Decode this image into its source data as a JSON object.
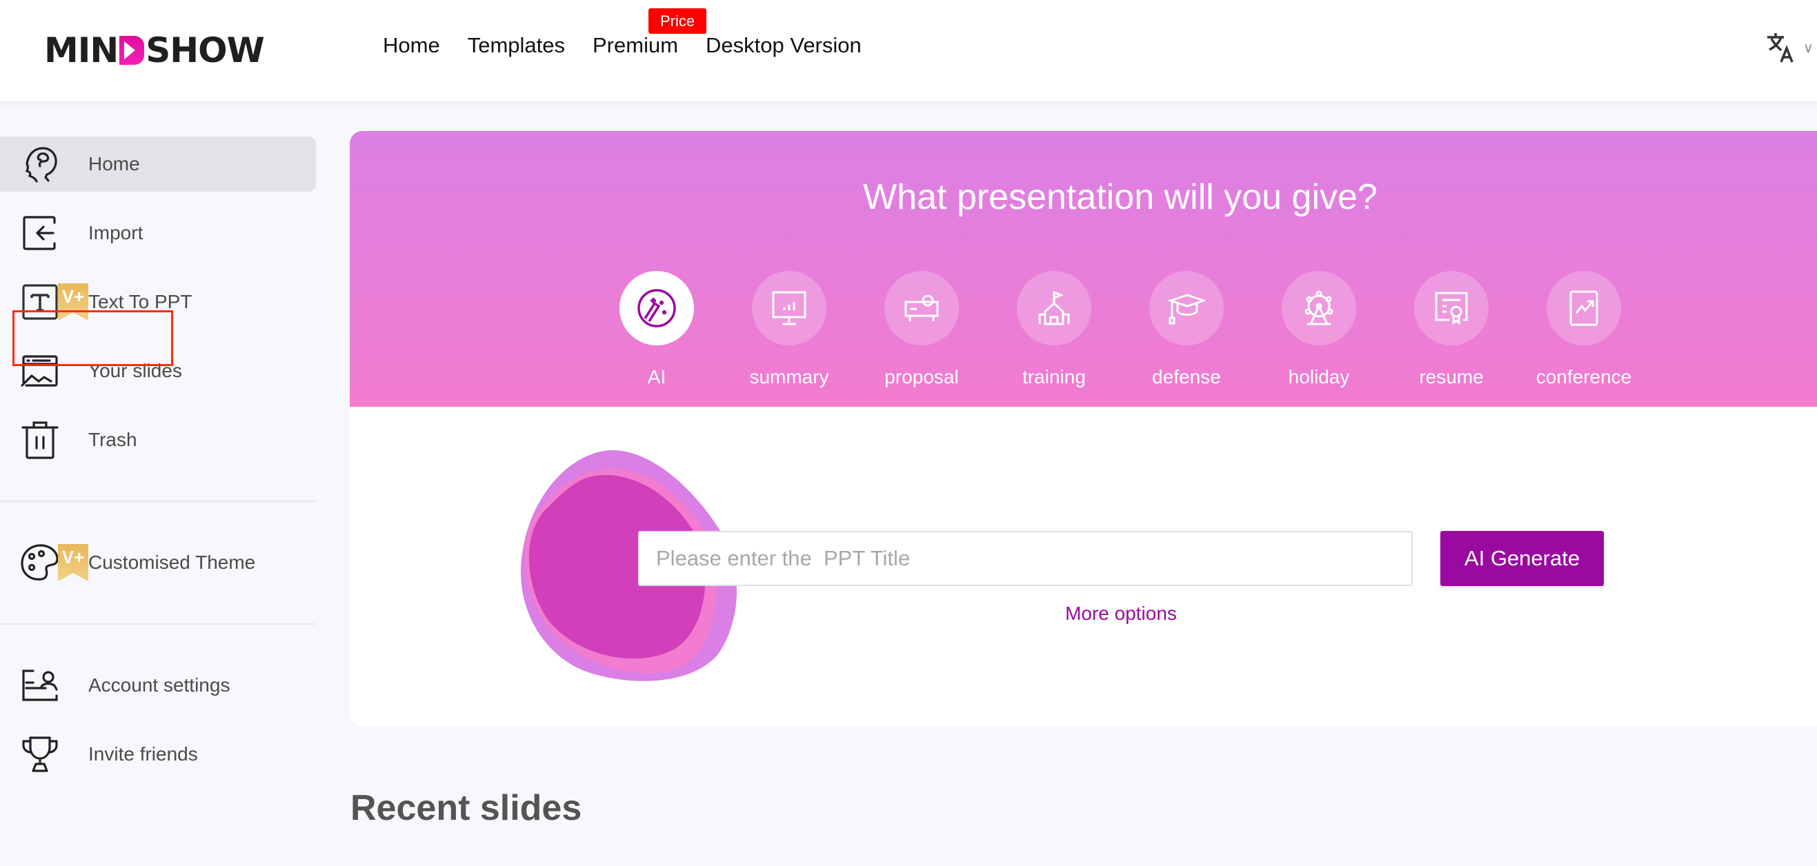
{
  "header": {
    "logo": {
      "part1": "MIN",
      "part2": "SHOW"
    },
    "nav": [
      {
        "label": "Home"
      },
      {
        "label": "Templates"
      },
      {
        "label": "Premium"
      },
      {
        "label": "Desktop Version"
      }
    ],
    "price_badge": "Price",
    "language_icon": "translate-icon"
  },
  "sidebar": {
    "items": [
      {
        "label": "Home",
        "icon": "brain-head-icon",
        "active": true
      },
      {
        "label": "Import",
        "icon": "import-icon",
        "highlighted": true
      },
      {
        "label": "Text To PPT",
        "icon": "text-icon",
        "badge": "V+"
      },
      {
        "label": "Your slides",
        "icon": "slides-icon"
      },
      {
        "label": "Trash",
        "icon": "trash-icon"
      },
      {
        "label": "Customised Theme",
        "icon": "palette-icon",
        "badge": "V+"
      },
      {
        "label": "Account settings",
        "icon": "account-icon"
      },
      {
        "label": "Invite friends",
        "icon": "trophy-icon"
      }
    ]
  },
  "banner": {
    "title": "What presentation will you give?",
    "categories": [
      {
        "label": "AI",
        "icon": "ai-magic-icon",
        "active": true
      },
      {
        "label": "summary",
        "icon": "chart-board-icon"
      },
      {
        "label": "proposal",
        "icon": "projector-icon"
      },
      {
        "label": "training",
        "icon": "school-flag-icon"
      },
      {
        "label": "defense",
        "icon": "graduation-cap-icon"
      },
      {
        "label": "holiday",
        "icon": "ferris-wheel-icon"
      },
      {
        "label": "resume",
        "icon": "certificate-icon"
      },
      {
        "label": "conference",
        "icon": "trend-chart-icon"
      }
    ]
  },
  "generator": {
    "input_value": "",
    "input_placeholder": "Please enter the  PPT Title",
    "generate_label": "AI Generate",
    "more_options_label": "More options"
  },
  "recent": {
    "title": "Recent slides"
  },
  "colors": {
    "accent": "#9b0aa0",
    "banner_top": "#dc80e4",
    "banner_bottom": "#f27ccf",
    "price_badge": "#ff0000",
    "vip_badge": "#e9b95a"
  }
}
